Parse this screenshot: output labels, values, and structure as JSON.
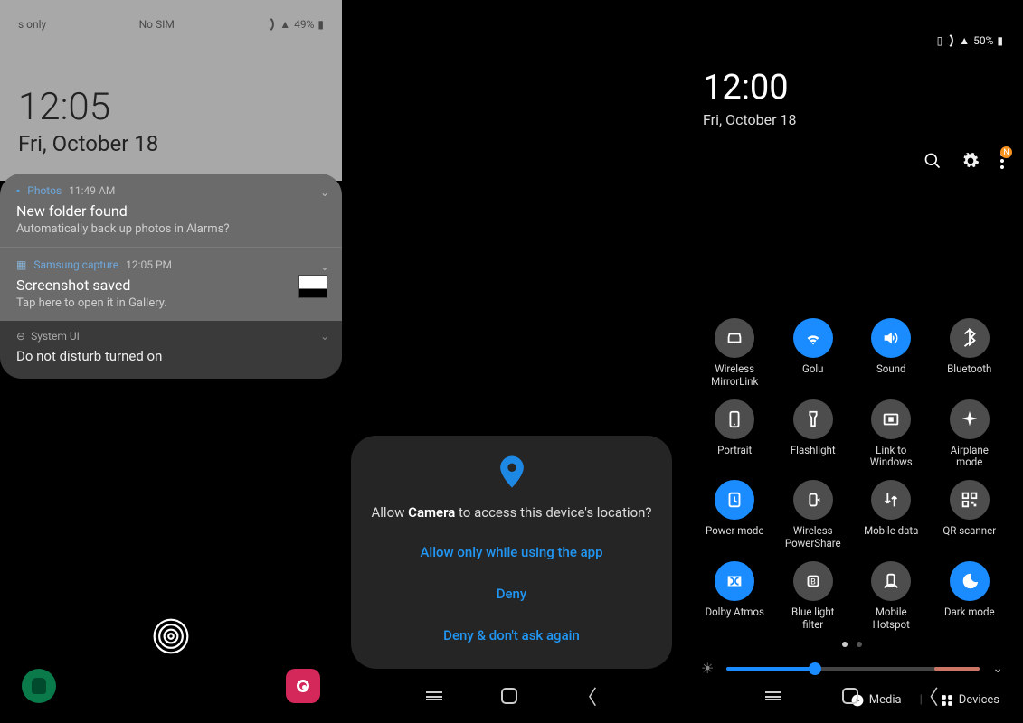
{
  "panel1": {
    "status": {
      "left": "s only",
      "sim": "No SIM",
      "battery": "49%"
    },
    "clock": {
      "time": "12:05",
      "date": "Fri, October 18"
    },
    "notifications": [
      {
        "app": "Photos",
        "time": "11:49 AM",
        "title": "New folder found",
        "body": "Automatically back up photos in Alarms?"
      },
      {
        "app": "Samsung capture",
        "time": "12:05 PM",
        "title": "Screenshot saved",
        "body": "Tap here to open it in Gallery."
      },
      {
        "app": "System UI",
        "title": "Do not disturb turned on"
      }
    ]
  },
  "panel2": {
    "dialog": {
      "msg_pre": "Allow ",
      "msg_bold": "Camera",
      "msg_post": " to access this device's location?",
      "allow": "Allow only while using the app",
      "deny": "Deny",
      "deny_forever": "Deny & don't ask again"
    }
  },
  "panel3": {
    "status": {
      "battery": "50%"
    },
    "clock": {
      "time": "12:00",
      "date": "Fri, October 18"
    },
    "badge": "N",
    "tiles": [
      {
        "label": "Wireless MirrorLink",
        "icon": "car",
        "on": false
      },
      {
        "label": "Golu",
        "icon": "wifi",
        "on": true
      },
      {
        "label": "Sound",
        "icon": "sound",
        "on": true
      },
      {
        "label": "Bluetooth",
        "icon": "bluetooth",
        "on": false
      },
      {
        "label": "Portrait",
        "icon": "portrait",
        "on": false
      },
      {
        "label": "Flashlight",
        "icon": "flashlight",
        "on": false
      },
      {
        "label": "Link to Windows",
        "icon": "link",
        "on": false
      },
      {
        "label": "Airplane mode",
        "icon": "airplane",
        "on": false
      },
      {
        "label": "Power mode",
        "icon": "power",
        "on": true
      },
      {
        "label": "Wireless PowerShare",
        "icon": "share-battery",
        "on": false
      },
      {
        "label": "Mobile data",
        "icon": "data",
        "on": false
      },
      {
        "label": "QR scanner",
        "icon": "qr",
        "on": false
      },
      {
        "label": "Dolby Atmos",
        "icon": "dolby",
        "on": true
      },
      {
        "label": "Blue light filter",
        "icon": "bluelight",
        "on": false
      },
      {
        "label": "Mobile Hotspot",
        "icon": "hotspot",
        "on": false
      },
      {
        "label": "Dark mode",
        "icon": "moon",
        "on": true
      }
    ],
    "slider": {
      "brightness": 35
    },
    "bottom": {
      "media": "Media",
      "devices": "Devices"
    }
  }
}
